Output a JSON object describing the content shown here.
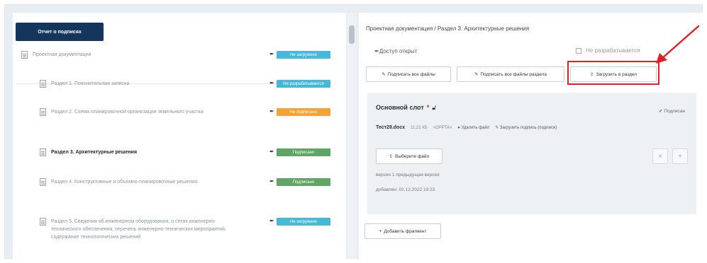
{
  "left_panel": {
    "report_button": "Отчет о подписях",
    "items": [
      {
        "label": "Проектная документация",
        "badge": "Не загружено",
        "badge_color": "cyan",
        "bold": false
      },
      {
        "label": "Раздел 1. Пояснительная записка",
        "badge": "Не разрабатывается",
        "badge_color": "cyan",
        "bold": false
      },
      {
        "label": "Раздел 2. Схема планировочной организации земельного участка",
        "badge": "Не подписано",
        "badge_color": "orange",
        "bold": false
      },
      {
        "label": "Раздел 3. Архитектурные решения",
        "badge": "Подписано",
        "badge_color": "green",
        "bold": true
      },
      {
        "label": "Раздел 4. Конструктивные и объемно-планировочные решения",
        "badge": "Подписано",
        "badge_color": "green",
        "bold": false
      },
      {
        "label": "Раздел 5. Сведения об инженерном оборудовании, о сетях инженерно-технического обеспечения, перечень инженерно-технических мероприятий, содержание технологических решений",
        "badge": "Не загружено",
        "badge_color": "cyan",
        "bold": false
      }
    ]
  },
  "right_panel": {
    "breadcrumb": "Проектная документация / Раздел 3. Архитектурные решения",
    "access": "Доступ открыт",
    "not_developed": "Не разрабатывается",
    "buttons": {
      "sign_all": "Подписать все файлы",
      "sign_all_section": "Подписать все файлы раздела",
      "upload_section": "Загрузить в раздел"
    },
    "slot": {
      "title": "Основной слот",
      "required_mark": "*",
      "signed": "Подписан",
      "file_name": "Тест28.docx",
      "file_size": "11,21 КБ",
      "file_status": "«OPPTA»",
      "delete_file": "Удалить файл",
      "upload_signature": "Загрузить подпись (подписи)",
      "choose_file": "Выберите файл",
      "version": "версия 1 предыдущая версия",
      "added": "добавлен: 02.12.2022 19:23"
    },
    "add_fragment": "Добавить фрагмент"
  },
  "colors": {
    "badge_cyan": "#45b9d8",
    "badge_orange": "#f3a233",
    "badge_green": "#5fa565",
    "primary_button": "#14365c",
    "highlight": "#e31e24"
  },
  "icons": [
    "document-icon",
    "pen-icon",
    "lock-icon",
    "sign-icon",
    "upload-icon",
    "check-icon",
    "plus-icon",
    "arrow-icon"
  ]
}
